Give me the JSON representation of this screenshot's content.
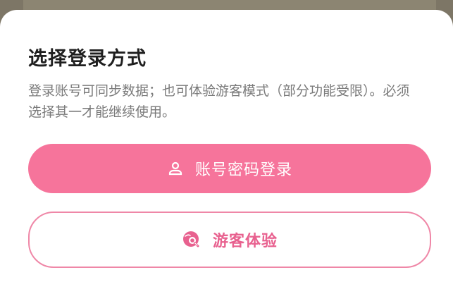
{
  "dialog": {
    "title": "选择登录方式",
    "description": "登录账号可同步数据；也可体验游客模式（部分功能受限）。必须选择其一才能继续使用。"
  },
  "buttons": {
    "account_login": {
      "label": "账号密码登录",
      "icon": "user-icon"
    },
    "guest_mode": {
      "label": "游客体验",
      "icon": "guest-search-icon"
    }
  },
  "colors": {
    "primary": "#f6749b",
    "secondary_text": "#e8618f",
    "secondary_border": "#ef87a7",
    "backdrop": "#7d7666"
  }
}
